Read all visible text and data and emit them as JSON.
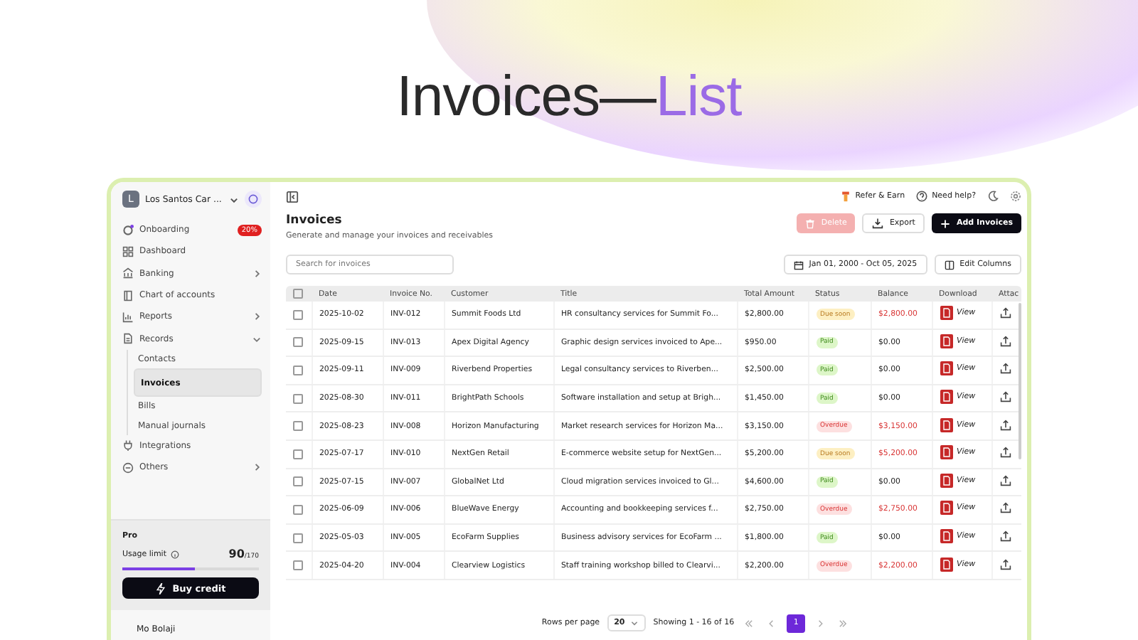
{
  "hero": {
    "title": "Invoices",
    "separator": "—",
    "accent": "List"
  },
  "sidebar": {
    "workspace": {
      "initial": "L",
      "name": "Los Santos Car ..."
    },
    "items": [
      {
        "label": "Onboarding",
        "badge": "20%",
        "selected": false
      },
      {
        "label": "Dashboard",
        "selected": false
      },
      {
        "label": "Banking",
        "expanded": false,
        "selected": false
      },
      {
        "label": "Chart of accounts",
        "selected": false
      },
      {
        "label": "Reports",
        "expanded": false,
        "selected": false
      },
      {
        "label": "Records",
        "expanded": true,
        "selected": false,
        "children": [
          {
            "label": "Contacts",
            "selected": false
          },
          {
            "label": "Invoices",
            "selected": true
          },
          {
            "label": "Bills",
            "selected": false
          },
          {
            "label": "Manual journals",
            "selected": false
          }
        ]
      },
      {
        "label": "Integrations",
        "selected": false
      },
      {
        "label": "Others",
        "expanded": false,
        "selected": false
      }
    ],
    "plan": {
      "name": "Pro",
      "usage_label": "Usage limit",
      "usage_value": "90",
      "usage_total": "/170",
      "level": 0.53,
      "button": "Buy credit"
    },
    "user": {
      "name": "Mo Bolaji"
    }
  },
  "topbar": {
    "refer": "Refer & Earn",
    "help": "Need help?"
  },
  "page": {
    "title": "Invoices",
    "subtitle": "Generate and manage your invoices and receivables",
    "actions": [
      {
        "label": "Delete",
        "kind": "danger",
        "disabled": true
      },
      {
        "label": "Export",
        "kind": "secondary",
        "disabled": false
      },
      {
        "label": "Add Invoices",
        "kind": "primary",
        "disabled": false
      }
    ],
    "search": {
      "placeholder": "Search for invoices"
    },
    "date_range": "Jan 01, 2000 - Oct 05, 2025",
    "edit_columns": "Edit Columns"
  },
  "table": {
    "all_checked": false,
    "columns": [
      "Date",
      "Invoice No.",
      "Customer",
      "Title",
      "Total Amount",
      "Status",
      "Balance",
      "Download",
      "Attac"
    ],
    "rows": [
      {
        "checked": false,
        "date": "2025-10-02",
        "number": "INV-012",
        "customer": "Summit Foods Ltd",
        "title": "HR consultancy services for Summit Fo...",
        "total": "$2,800.00",
        "status": {
          "label": "Due soon",
          "kind": "due"
        },
        "balance": "$2,800.00",
        "download": "View"
      },
      {
        "checked": false,
        "date": "2025-09-15",
        "number": "INV-013",
        "customer": "Apex Digital Agency",
        "title": "Graphic design services invoiced to Ape...",
        "total": "$950.00",
        "status": {
          "label": "Paid",
          "kind": "paid"
        },
        "balance": "$0.00",
        "download": "View"
      },
      {
        "checked": false,
        "date": "2025-09-11",
        "number": "INV-009",
        "customer": "Riverbend Properties",
        "title": "Legal consultancy services to Riverben...",
        "total": "$2,500.00",
        "status": {
          "label": "Paid",
          "kind": "paid"
        },
        "balance": "$0.00",
        "download": "View"
      },
      {
        "checked": false,
        "date": "2025-08-30",
        "number": "INV-011",
        "customer": "BrightPath Schools",
        "title": "Software installation and setup at Brigh...",
        "total": "$1,450.00",
        "status": {
          "label": "Paid",
          "kind": "paid"
        },
        "balance": "$0.00",
        "download": "View"
      },
      {
        "checked": false,
        "date": "2025-08-23",
        "number": "INV-008",
        "customer": "Horizon Manufacturing",
        "title": "Market research services for Horizon Ma...",
        "total": "$3,150.00",
        "status": {
          "label": "Overdue",
          "kind": "overdue"
        },
        "balance": "$3,150.00",
        "download": "View"
      },
      {
        "checked": false,
        "date": "2025-07-17",
        "number": "INV-010",
        "customer": "NextGen Retail",
        "title": "E-commerce website setup for NextGen...",
        "total": "$5,200.00",
        "status": {
          "label": "Due soon",
          "kind": "due"
        },
        "balance": "$5,200.00",
        "download": "View"
      },
      {
        "checked": false,
        "date": "2025-07-15",
        "number": "INV-007",
        "customer": "GlobalNet Ltd",
        "title": "Cloud migration services invoiced to Gl...",
        "total": "$4,600.00",
        "status": {
          "label": "Paid",
          "kind": "paid"
        },
        "balance": "$0.00",
        "download": "View"
      },
      {
        "checked": false,
        "date": "2025-06-09",
        "number": "INV-006",
        "customer": "BlueWave Energy",
        "title": "Accounting and bookkeeping services f...",
        "total": "$2,750.00",
        "status": {
          "label": "Overdue",
          "kind": "overdue"
        },
        "balance": "$2,750.00",
        "download": "View"
      },
      {
        "checked": false,
        "date": "2025-05-03",
        "number": "INV-005",
        "customer": "EcoFarm Supplies",
        "title": "Business advisory services for EcoFarm ...",
        "total": "$1,800.00",
        "status": {
          "label": "Paid",
          "kind": "paid"
        },
        "balance": "$0.00",
        "download": "View"
      },
      {
        "checked": false,
        "date": "2025-04-20",
        "number": "INV-004",
        "customer": "Clearview Logistics",
        "title": "Staff training workshop billed to Clearvi...",
        "total": "$2,200.00",
        "status": {
          "label": "Overdue",
          "kind": "overdue"
        },
        "balance": "$2,200.00",
        "download": "View"
      }
    ]
  },
  "pagination": {
    "rows_label": "Rows per page",
    "rows_value": "20",
    "showing": "Showing 1 - 16 of 16",
    "pages": [
      {
        "label": "1",
        "selected": true
      }
    ]
  }
}
